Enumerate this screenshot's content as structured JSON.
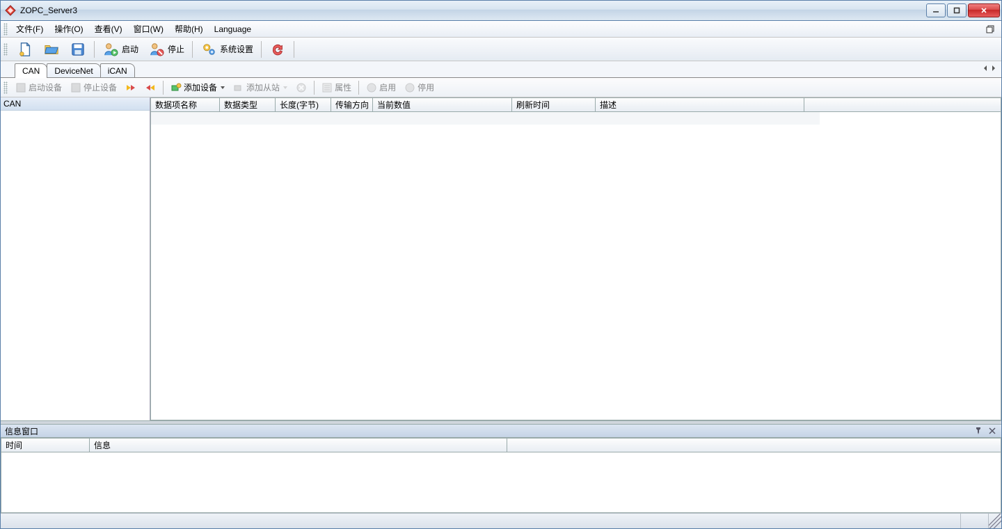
{
  "window": {
    "title": "ZOPC_Server3"
  },
  "menu": {
    "file": "文件(F)",
    "operate": "操作(O)",
    "view": "查看(V)",
    "window": "窗口(W)",
    "help": "帮助(H)",
    "language": "Language"
  },
  "toolbar": {
    "start": "启动",
    "stop": "停止",
    "settings": "系统设置"
  },
  "tabs": {
    "can": "CAN",
    "devicenet": "DeviceNet",
    "ican": "iCAN"
  },
  "subtoolbar": {
    "startDevice": "启动设备",
    "stopDevice": "停止设备",
    "addDevice": "添加设备",
    "addSlave": "添加从站",
    "properties": "属性",
    "enable": "启用",
    "disable": "停用"
  },
  "tree": {
    "root": "CAN"
  },
  "gridColumns": {
    "name": "数据项名称",
    "type": "数据类型",
    "length": "长度(字节)",
    "direction": "传输方向",
    "currentValue": "当前数值",
    "refreshTime": "刷新时间",
    "description": "描述"
  },
  "infoPane": {
    "title": "信息窗口",
    "colTime": "时间",
    "colInfo": "信息"
  }
}
